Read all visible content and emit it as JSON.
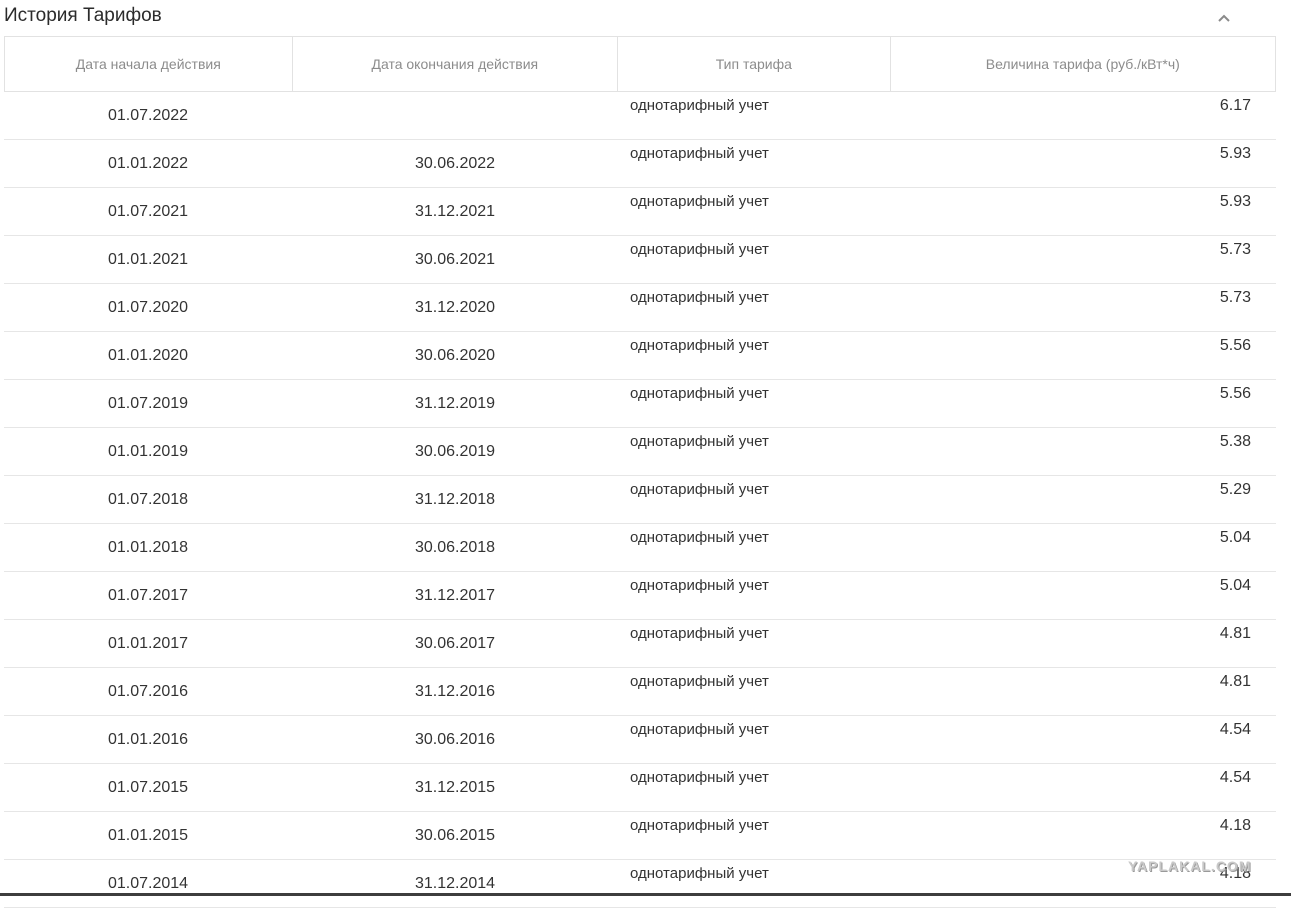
{
  "section": {
    "title": "История Тарифов",
    "collapse_icon": "chevron-up-icon"
  },
  "table": {
    "headers": [
      "Дата начала действия",
      "Дата окончания действия",
      "Тип тарифа",
      "Величина тарифа (руб./кВт*ч)"
    ],
    "rows": [
      {
        "start": "01.07.2022",
        "end": "",
        "type": "однотарифный учет",
        "value": "6.17"
      },
      {
        "start": "01.01.2022",
        "end": "30.06.2022",
        "type": "однотарифный учет",
        "value": "5.93"
      },
      {
        "start": "01.07.2021",
        "end": "31.12.2021",
        "type": "однотарифный учет",
        "value": "5.93"
      },
      {
        "start": "01.01.2021",
        "end": "30.06.2021",
        "type": "однотарифный учет",
        "value": "5.73"
      },
      {
        "start": "01.07.2020",
        "end": "31.12.2020",
        "type": "однотарифный учет",
        "value": "5.73"
      },
      {
        "start": "01.01.2020",
        "end": "30.06.2020",
        "type": "однотарифный учет",
        "value": "5.56"
      },
      {
        "start": "01.07.2019",
        "end": "31.12.2019",
        "type": "однотарифный учет",
        "value": "5.56"
      },
      {
        "start": "01.01.2019",
        "end": "30.06.2019",
        "type": "однотарифный учет",
        "value": "5.38"
      },
      {
        "start": "01.07.2018",
        "end": "31.12.2018",
        "type": "однотарифный учет",
        "value": "5.29"
      },
      {
        "start": "01.01.2018",
        "end": "30.06.2018",
        "type": "однотарифный учет",
        "value": "5.04"
      },
      {
        "start": "01.07.2017",
        "end": "31.12.2017",
        "type": "однотарифный учет",
        "value": "5.04"
      },
      {
        "start": "01.01.2017",
        "end": "30.06.2017",
        "type": "однотарифный учет",
        "value": "4.81"
      },
      {
        "start": "01.07.2016",
        "end": "31.12.2016",
        "type": "однотарифный учет",
        "value": "4.81"
      },
      {
        "start": "01.01.2016",
        "end": "30.06.2016",
        "type": "однотарифный учет",
        "value": "4.54"
      },
      {
        "start": "01.07.2015",
        "end": "31.12.2015",
        "type": "однотарифный учет",
        "value": "4.54"
      },
      {
        "start": "01.01.2015",
        "end": "30.06.2015",
        "type": "однотарифный учет",
        "value": "4.18"
      },
      {
        "start": "01.07.2014",
        "end": "31.12.2014",
        "type": "однотарифный учет",
        "value": "4.18"
      }
    ]
  },
  "watermark": "YAPLAKAL.COM"
}
